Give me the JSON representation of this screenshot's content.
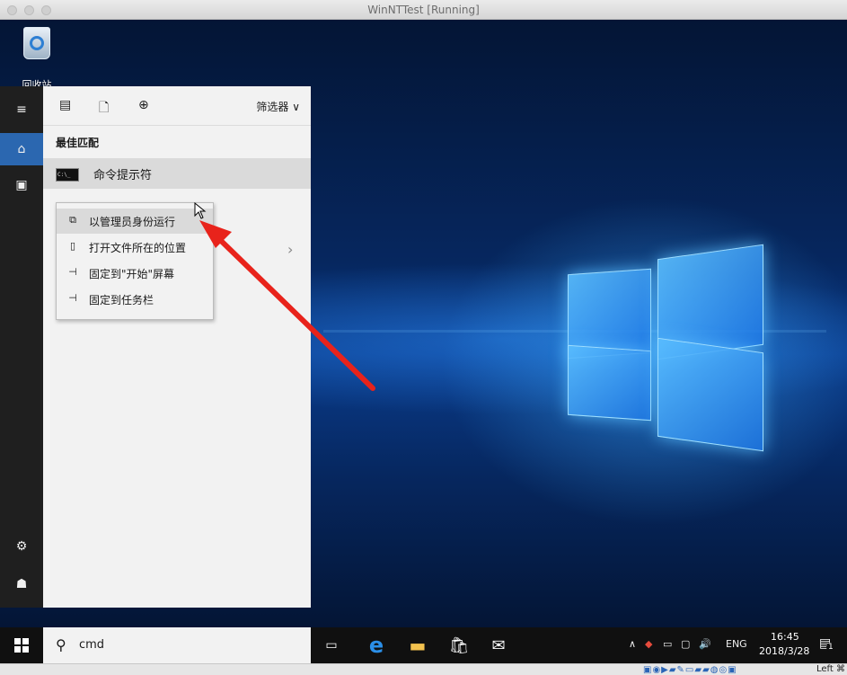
{
  "window": {
    "title": "WinNTTest [Running]"
  },
  "desktop": {
    "recycle_bin_label": "回收站"
  },
  "start_sidebar": {
    "items": [
      {
        "name": "menu",
        "icon": "hamburger-icon",
        "glyph": "≡"
      },
      {
        "name": "home",
        "icon": "home-icon",
        "glyph": "⌂",
        "active": true
      },
      {
        "name": "documents",
        "icon": "document-icon",
        "glyph": "▣"
      },
      {
        "name": "settings",
        "icon": "gear-icon",
        "glyph": "⚙"
      },
      {
        "name": "user",
        "icon": "user-icon",
        "glyph": "☗"
      }
    ]
  },
  "search_panel": {
    "filters": [
      {
        "icon": "apps-icon",
        "glyph": "▤"
      },
      {
        "icon": "document-icon",
        "glyph": "🗋"
      },
      {
        "icon": "web-icon",
        "glyph": "⊕"
      }
    ],
    "filter_label": "筛选器 ∨",
    "best_match_heading": "最佳匹配",
    "result": {
      "label": "命令提示符",
      "thumb_text": "C:\\_"
    },
    "chevron": "›"
  },
  "context_menu": {
    "items": [
      {
        "label": "以管理员身份运行",
        "icon": "shield-run-icon",
        "glyph": "⧉",
        "hover": true
      },
      {
        "label": "打开文件所在的位置",
        "icon": "folder-location-icon",
        "glyph": "▯"
      },
      {
        "label": "固定到\"开始\"屏幕",
        "icon": "pin-icon",
        "glyph": "⊣"
      },
      {
        "label": "固定到任务栏",
        "icon": "pin-icon",
        "glyph": "⊣"
      }
    ]
  },
  "taskbar": {
    "search_query": "cmd",
    "apps": [
      {
        "icon": "task-view-icon",
        "glyph": "▭"
      },
      {
        "icon": "edge-icon",
        "glyph": "e",
        "color": "#2b8fe8"
      },
      {
        "icon": "file-explorer-icon",
        "glyph": "▬",
        "color": "#f2c14e"
      },
      {
        "icon": "store-icon",
        "glyph": "🛍"
      },
      {
        "icon": "mail-icon",
        "glyph": "✉"
      }
    ],
    "tray": {
      "chevron": "∧",
      "language": "ENG",
      "volume": "🔊",
      "time": "16:45",
      "date": "2018/3/28",
      "notifications": "1"
    }
  },
  "vbox_status": {
    "host_key": "Left ⌘"
  },
  "colors": {
    "accent": "#2b67b0",
    "arrow": "#e8231b"
  }
}
